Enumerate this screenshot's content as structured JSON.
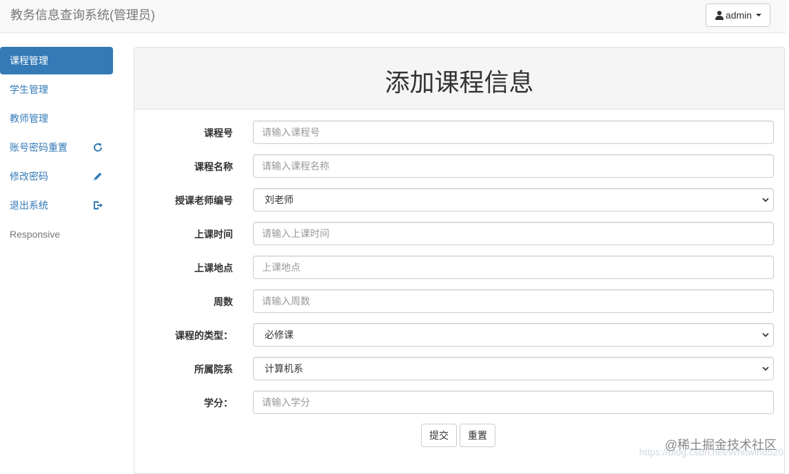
{
  "navbar": {
    "brand": "教务信息查询系统(管理员)",
    "user_label": "admin"
  },
  "sidebar": {
    "items": [
      {
        "label": "课程管理",
        "icon": ""
      },
      {
        "label": "学生管理",
        "icon": ""
      },
      {
        "label": "教师管理",
        "icon": ""
      },
      {
        "label": "账号密码重置",
        "icon": "refresh-icon"
      },
      {
        "label": "修改密码",
        "icon": "pencil-icon"
      },
      {
        "label": "退出系统",
        "icon": "logout-icon"
      },
      {
        "label": "Responsive",
        "icon": ""
      }
    ]
  },
  "main": {
    "title": "添加课程信息",
    "fields": [
      {
        "label": "课程号",
        "type": "input",
        "placeholder": "请输入课程号",
        "value": ""
      },
      {
        "label": "课程名称",
        "type": "input",
        "placeholder": "请输入课程名称",
        "value": ""
      },
      {
        "label": "授课老师编号",
        "type": "select",
        "value": "刘老师"
      },
      {
        "label": "上课时间",
        "type": "input",
        "placeholder": "请输入上课时间",
        "value": ""
      },
      {
        "label": "上课地点",
        "type": "input",
        "placeholder": "上课地点",
        "value": ""
      },
      {
        "label": "周数",
        "type": "input",
        "placeholder": "请输入周数",
        "value": ""
      },
      {
        "label": "课程的类型：",
        "type": "select",
        "value": "必修课"
      },
      {
        "label": "所属院系",
        "type": "select",
        "value": "计算机系"
      },
      {
        "label": "学分：",
        "type": "input",
        "placeholder": "请输入学分",
        "value": ""
      }
    ],
    "buttons": {
      "submit": "提交",
      "reset": "重置"
    }
  },
  "watermark": {
    "text": "@稀土掘金技术社区",
    "url": "https://blog.csdn.net/Whitwind520"
  },
  "colors": {
    "primary": "#337ab7",
    "navbar_bg": "#f8f8f8",
    "panel_heading_bg": "#f5f5f5"
  }
}
